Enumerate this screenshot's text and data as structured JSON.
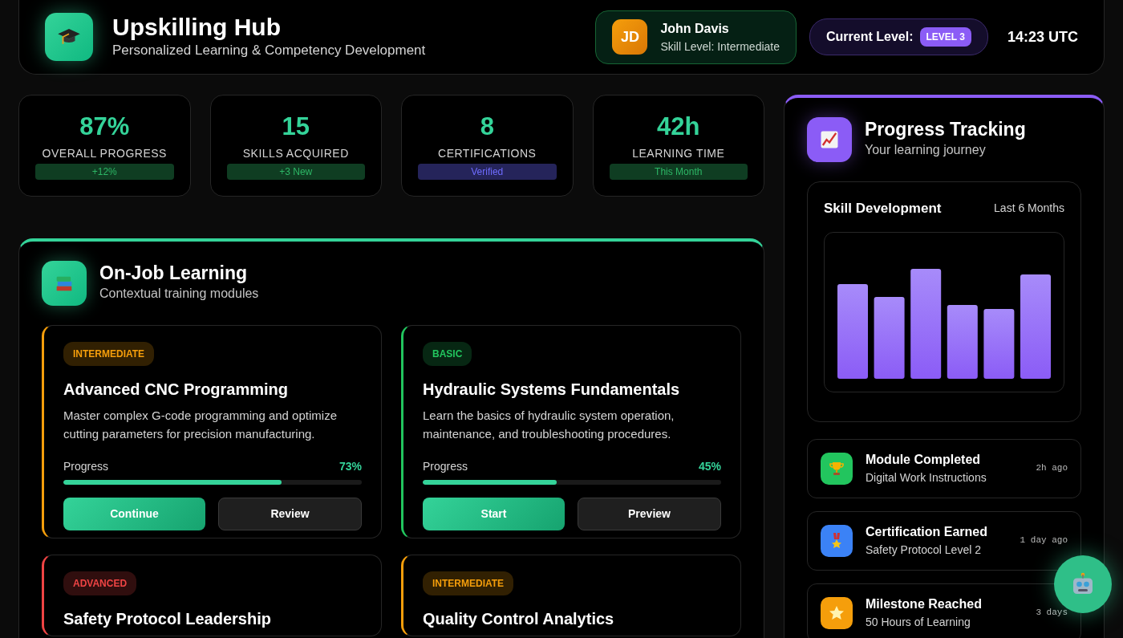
{
  "header": {
    "title": "Upskilling Hub",
    "subtitle": "Personalized Learning & Competency Development",
    "user": {
      "initials": "JD",
      "name": "John Davis",
      "skill": "Skill Level: Intermediate"
    },
    "level_label": "Current Level:",
    "level_badge": "LEVEL 3",
    "time": "14:23 UTC"
  },
  "stats": [
    {
      "value": "87%",
      "label": "OVERALL PROGRESS",
      "badge": "+12%",
      "color": "#0f3d22"
    },
    {
      "value": "15",
      "label": "SKILLS ACQUIRED",
      "badge": "+3 New",
      "color": "#0f3d22"
    },
    {
      "value": "8",
      "label": "CERTIFICATIONS",
      "badge": "Verified",
      "color": "#25245a"
    },
    {
      "value": "42h",
      "label": "LEARNING TIME",
      "badge": "This Month",
      "color": "#0f3d22"
    }
  ],
  "learning": {
    "title": "On-Job Learning",
    "subtitle": "Contextual training modules",
    "modules": [
      {
        "difficulty": "INTERMEDIATE",
        "color": "#f59e0b",
        "title": "Advanced CNC Programming",
        "description": "Master complex G-code programming and optimize cutting parameters for precision manufacturing.",
        "progress_label": "Progress",
        "level": 0.73,
        "reading": "73%",
        "buttons": [
          {
            "label": "Continue",
            "kind": "primary"
          },
          {
            "label": "Review",
            "kind": "secondary"
          }
        ]
      },
      {
        "difficulty": "BASIC",
        "color": "#22c55e",
        "title": "Hydraulic Systems Fundamentals",
        "description": "Learn the basics of hydraulic system operation, maintenance, and troubleshooting procedures.",
        "progress_label": "Progress",
        "level": 0.45,
        "reading": "45%",
        "buttons": [
          {
            "label": "Start",
            "kind": "primary"
          },
          {
            "label": "Preview",
            "kind": "secondary"
          }
        ]
      },
      {
        "difficulty": "ADVANCED",
        "color": "#ef4444",
        "title": "Safety Protocol Leadership"
      },
      {
        "difficulty": "INTERMEDIATE",
        "color": "#f59e0b",
        "title": "Quality Control Analytics"
      }
    ]
  },
  "tracking": {
    "title": "Progress Tracking",
    "subtitle": "Your learning journey",
    "chart_title": "Skill Development",
    "chart_period": "Last 6 Months",
    "activities": [
      {
        "kind": "trophy",
        "color": "#22c55e",
        "title": "Module Completed",
        "detail": "Digital Work Instructions",
        "time": "2h ago"
      },
      {
        "kind": "medal",
        "color": "#3b82f6",
        "title": "Certification Earned",
        "detail": "Safety Protocol Level 2",
        "time": "1 day ago"
      },
      {
        "kind": "star",
        "color": "#f59e0b",
        "title": "Milestone Reached",
        "detail": "50 Hours of Learning",
        "time": "3 days"
      }
    ]
  }
}
